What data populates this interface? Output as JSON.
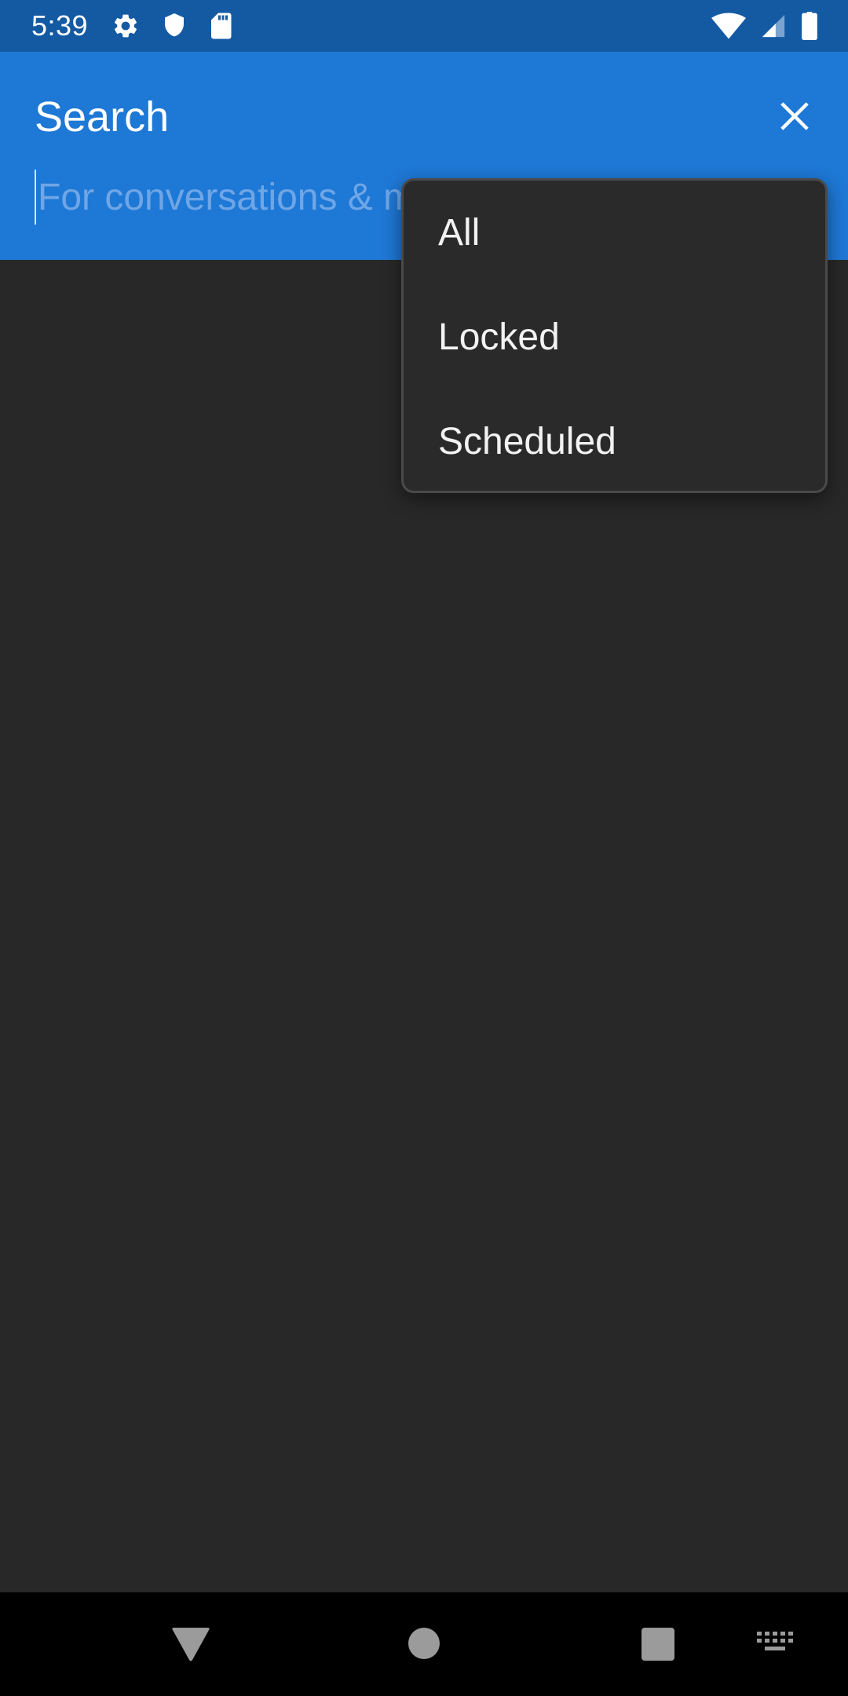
{
  "status_bar": {
    "time": "5:39",
    "left_icons": [
      "gear-icon",
      "shield-icon",
      "sd-card-icon"
    ],
    "right_icons": [
      "wifi-icon",
      "signal-icon",
      "battery-icon"
    ],
    "background": "#145aa3"
  },
  "header": {
    "title": "Search",
    "close_icon": "close-icon",
    "background": "#1e78d6"
  },
  "search": {
    "placeholder": "For conversations & messages",
    "value": ""
  },
  "dropdown": {
    "items": [
      {
        "label": "All"
      },
      {
        "label": "Locked"
      },
      {
        "label": "Scheduled"
      }
    ]
  },
  "nav_bar": {
    "buttons": [
      "back-icon",
      "home-icon",
      "recents-icon",
      "keyboard-icon"
    ]
  },
  "colors": {
    "content_background": "#282828",
    "menu_background": "#2a2a2a",
    "accent": "#1e78d6"
  }
}
